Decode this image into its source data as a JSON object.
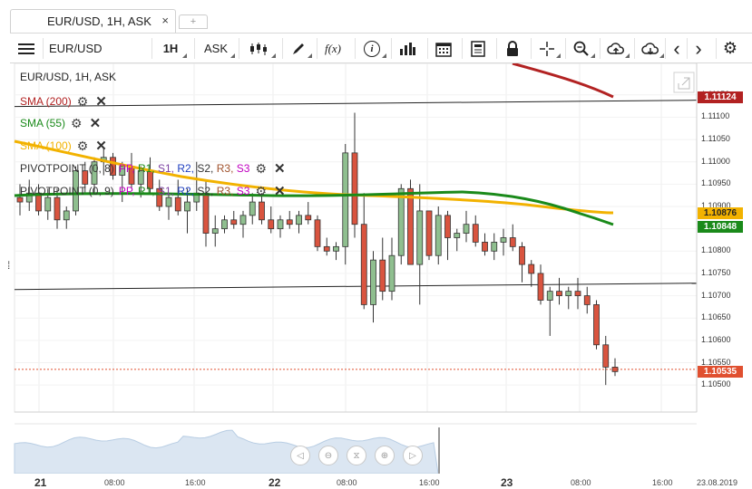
{
  "tab": {
    "label": "EUR/USD, 1H, ASK",
    "close": "×",
    "add": "+"
  },
  "toolbar": {
    "menu_icon": "menu-icon",
    "symbol": "EUR/USD",
    "timeframe": "1H",
    "price_type": "ASK",
    "fx_label": "f(x)",
    "info_label": "i",
    "prev": "‹",
    "next": "›"
  },
  "chart": {
    "title": "EUR/USD, 1H, ASK",
    "indicators": [
      {
        "label": "SMA (200)",
        "color": "#b22222"
      },
      {
        "label": "SMA (55)",
        "color": "#1a8a1a"
      },
      {
        "label": "SMA (100)",
        "color": "#f2b200"
      }
    ],
    "pivots": [
      {
        "prefix": "PIVOTPOINT (0, 8)",
        "items": [
          "PP,",
          "R1,",
          "S1,",
          "R2,",
          "S2,",
          "R3,",
          "S3"
        ]
      },
      {
        "prefix": "PIVOTPOINT (0, 9)",
        "items": [
          "PP,",
          "R1,",
          "S1,",
          "R2,",
          "S2,",
          "R3,",
          "S3"
        ]
      }
    ],
    "pivot_colors": [
      "#c000c0",
      "#1a8a1a",
      "#7b3fa0",
      "#1f3fbf",
      "#333333",
      "#a0522d",
      "#c000c0"
    ],
    "y_ticks": [
      "1.11150",
      "1.11100",
      "1.11050",
      "1.11000",
      "1.10950",
      "1.10900",
      "1.10850",
      "1.10800",
      "1.10750",
      "1.10700",
      "1.10650",
      "1.10600",
      "1.10550",
      "1.10500"
    ],
    "badges": {
      "sma200": {
        "value": "1.11124",
        "color": "#b22222"
      },
      "sma100": {
        "value": "1.10876",
        "color": "#f2b200"
      },
      "sma55": {
        "value": "1.10848",
        "color": "#1a8a1a"
      },
      "last": {
        "value": "1.10535",
        "color": "#e05030"
      }
    },
    "days": [
      "21",
      "22",
      "23"
    ],
    "times": [
      "08:00",
      "16:00",
      "08:00",
      "16:00",
      "08:00",
      "16:00"
    ],
    "end_date": "23.08.2019"
  },
  "chart_data": {
    "type": "candlestick",
    "ylim": [
      1.1048,
      1.1118
    ],
    "candles": [
      [
        1.1092,
        1.1095,
        1.1088,
        1.1091
      ],
      [
        1.1091,
        1.1096,
        1.1089,
        1.1093
      ],
      [
        1.1093,
        1.1095,
        1.1088,
        1.1089
      ],
      [
        1.1089,
        1.1094,
        1.1087,
        1.1092
      ],
      [
        1.1092,
        1.1094,
        1.1085,
        1.1087
      ],
      [
        1.1087,
        1.109,
        1.1085,
        1.1089
      ],
      [
        1.1089,
        1.1099,
        1.1088,
        1.1098
      ],
      [
        1.1098,
        1.11,
        1.1093,
        1.1095
      ],
      [
        1.1095,
        1.1101,
        1.1093,
        1.11
      ],
      [
        1.11,
        1.1103,
        1.1097,
        1.1101
      ],
      [
        1.1101,
        1.1102,
        1.1096,
        1.1097
      ],
      [
        1.1097,
        1.11,
        1.1091,
        1.1099
      ],
      [
        1.1099,
        1.1102,
        1.1094,
        1.1095
      ],
      [
        1.1095,
        1.1099,
        1.1092,
        1.1098
      ],
      [
        1.1098,
        1.1101,
        1.1093,
        1.1094
      ],
      [
        1.1094,
        1.1096,
        1.1089,
        1.109
      ],
      [
        1.109,
        1.1093,
        1.1087,
        1.1092
      ],
      [
        1.1092,
        1.1096,
        1.1088,
        1.1089
      ],
      [
        1.1089,
        1.1094,
        1.1084,
        1.1091
      ],
      [
        1.1091,
        1.11,
        1.1089,
        1.1093
      ],
      [
        1.1093,
        1.1096,
        1.1081,
        1.1084
      ],
      [
        1.1084,
        1.1088,
        1.1081,
        1.1085
      ],
      [
        1.1085,
        1.1088,
        1.1084,
        1.1087
      ],
      [
        1.1087,
        1.1089,
        1.1085,
        1.1086
      ],
      [
        1.1086,
        1.1089,
        1.1083,
        1.1088
      ],
      [
        1.1088,
        1.1093,
        1.1086,
        1.1091
      ],
      [
        1.1091,
        1.1093,
        1.1086,
        1.1087
      ],
      [
        1.1087,
        1.109,
        1.1084,
        1.1085
      ],
      [
        1.1085,
        1.1088,
        1.1083,
        1.1087
      ],
      [
        1.1087,
        1.1089,
        1.1085,
        1.1086
      ],
      [
        1.1086,
        1.1089,
        1.1084,
        1.1088
      ],
      [
        1.1088,
        1.1091,
        1.1086,
        1.1087
      ],
      [
        1.1087,
        1.1088,
        1.108,
        1.1081
      ],
      [
        1.1081,
        1.1083,
        1.1079,
        1.108
      ],
      [
        1.108,
        1.1082,
        1.1078,
        1.1081
      ],
      [
        1.1081,
        1.1104,
        1.1077,
        1.1102
      ],
      [
        1.1102,
        1.1111,
        1.1083,
        1.1086
      ],
      [
        1.1086,
        1.1093,
        1.1067,
        1.1068
      ],
      [
        1.1068,
        1.108,
        1.1064,
        1.1078
      ],
      [
        1.1078,
        1.1083,
        1.1069,
        1.1071
      ],
      [
        1.1071,
        1.1083,
        1.1069,
        1.1079
      ],
      [
        1.1079,
        1.1095,
        1.1077,
        1.1094
      ],
      [
        1.1094,
        1.1096,
        1.1077,
        1.1077
      ],
      [
        1.1077,
        1.1095,
        1.1068,
        1.1089
      ],
      [
        1.1089,
        1.1089,
        1.1078,
        1.1079
      ],
      [
        1.1079,
        1.109,
        1.1077,
        1.1088
      ],
      [
        1.1088,
        1.1089,
        1.1078,
        1.1083
      ],
      [
        1.1083,
        1.1085,
        1.108,
        1.1084
      ],
      [
        1.1084,
        1.1089,
        1.1082,
        1.1086
      ],
      [
        1.1086,
        1.1088,
        1.1081,
        1.1082
      ],
      [
        1.1082,
        1.1084,
        1.1079,
        1.108
      ],
      [
        1.108,
        1.1084,
        1.1078,
        1.1082
      ],
      [
        1.1082,
        1.1085,
        1.1079,
        1.1083
      ],
      [
        1.1083,
        1.1086,
        1.108,
        1.1081
      ],
      [
        1.1081,
        1.1082,
        1.1073,
        1.1077
      ],
      [
        1.1077,
        1.1078,
        1.1072,
        1.1075
      ],
      [
        1.1075,
        1.1077,
        1.1068,
        1.1069
      ],
      [
        1.1069,
        1.1072,
        1.1061,
        1.1071
      ],
      [
        1.1071,
        1.1074,
        1.1068,
        1.107
      ],
      [
        1.107,
        1.1072,
        1.1067,
        1.1071
      ],
      [
        1.1071,
        1.1074,
        1.1067,
        1.107
      ],
      [
        1.107,
        1.1072,
        1.1066,
        1.1068
      ],
      [
        1.1068,
        1.1069,
        1.1058,
        1.1059
      ],
      [
        1.1059,
        1.1061,
        1.105,
        1.1054
      ],
      [
        1.1054,
        1.1056,
        1.1052,
        1.1053
      ]
    ],
    "hlines": [
      1.1113,
      1.1072
    ],
    "last_price": 1.10535
  }
}
